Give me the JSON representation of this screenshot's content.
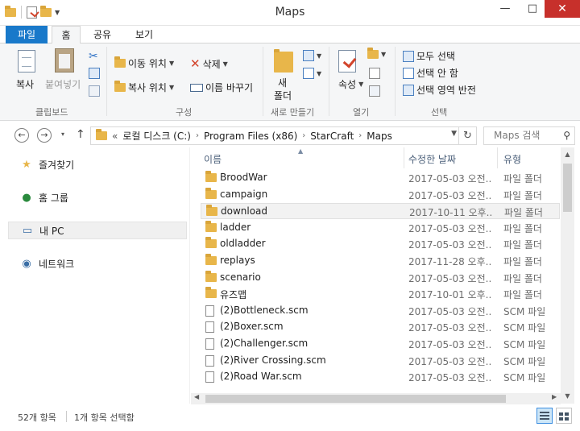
{
  "window": {
    "title": "Maps",
    "minimize": "—",
    "maximize": "□",
    "close": "✕"
  },
  "ribbon_tabs": {
    "file": "파일",
    "home": "홈",
    "share": "공유",
    "view": "보기",
    "collapse": "∨",
    "help": "?"
  },
  "ribbon": {
    "clipboard": {
      "copy": "복사",
      "paste": "붙여넣기",
      "label": "클립보드"
    },
    "organize": {
      "move_to": "이동 위치",
      "copy_to": "복사 위치",
      "delete": "삭제",
      "rename": "이름 바꾸기",
      "label": "구성"
    },
    "new": {
      "new_folder_line1": "새",
      "new_folder_line2": "폴더",
      "label": "새로 만들기"
    },
    "open": {
      "properties": "속성",
      "label": "열기"
    },
    "select": {
      "select_all": "모두 선택",
      "select_none": "선택 안 함",
      "invert": "선택 영역 반전",
      "label": "선택"
    }
  },
  "navigation": {
    "back": "←",
    "forward": "→",
    "recent": "▾",
    "up": "↑",
    "address": {
      "overflow": "«",
      "segments": [
        "로컬 디스크 (C:)",
        "Program Files (x86)",
        "StarCraft",
        "Maps"
      ]
    },
    "search": {
      "placeholder": "Maps 검색"
    }
  },
  "nav_pane": [
    {
      "label": "즐겨찾기",
      "icon": "star-icon"
    },
    {
      "label": "홈 그룹",
      "icon": "homegroup-icon"
    },
    {
      "label": "내 PC",
      "icon": "computer-icon",
      "selected": true
    },
    {
      "label": "네트워크",
      "icon": "network-icon"
    }
  ],
  "columns": {
    "name": "이름",
    "modified": "수정한 날짜",
    "type": "유형"
  },
  "files": [
    {
      "name": "BroodWar",
      "modified": "2017-05-03 오전...",
      "type": "파일 폴더",
      "kind": "folder"
    },
    {
      "name": "campaign",
      "modified": "2017-05-03 오전...",
      "type": "파일 폴더",
      "kind": "folder"
    },
    {
      "name": "download",
      "modified": "2017-10-11 오후...",
      "type": "파일 폴더",
      "kind": "folder",
      "selected": true
    },
    {
      "name": "ladder",
      "modified": "2017-05-03 오전...",
      "type": "파일 폴더",
      "kind": "folder"
    },
    {
      "name": "oldladder",
      "modified": "2017-05-03 오전...",
      "type": "파일 폴더",
      "kind": "folder"
    },
    {
      "name": "replays",
      "modified": "2017-11-28 오후...",
      "type": "파일 폴더",
      "kind": "folder"
    },
    {
      "name": "scenario",
      "modified": "2017-05-03 오전...",
      "type": "파일 폴더",
      "kind": "folder"
    },
    {
      "name": "유즈맵",
      "modified": "2017-10-01 오후...",
      "type": "파일 폴더",
      "kind": "folder"
    },
    {
      "name": "(2)Bottleneck.scm",
      "modified": "2017-05-03 오전...",
      "type": "SCM 파일",
      "kind": "file"
    },
    {
      "name": "(2)Boxer.scm",
      "modified": "2017-05-03 오전...",
      "type": "SCM 파일",
      "kind": "file"
    },
    {
      "name": "(2)Challenger.scm",
      "modified": "2017-05-03 오전...",
      "type": "SCM 파일",
      "kind": "file"
    },
    {
      "name": "(2)River Crossing.scm",
      "modified": "2017-05-03 오전...",
      "type": "SCM 파일",
      "kind": "file"
    },
    {
      "name": "(2)Road War.scm",
      "modified": "2017-05-03 오전...",
      "type": "SCM 파일",
      "kind": "file"
    }
  ],
  "status": {
    "item_count": "52개 항목",
    "selected": "1개 항목 선택함"
  },
  "colors": {
    "accent": "#1979ca",
    "close": "#c7302b",
    "folder": "#e8b64a"
  }
}
